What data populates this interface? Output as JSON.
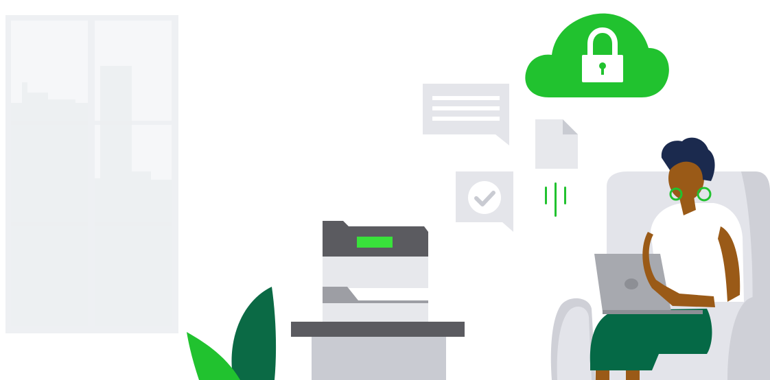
{
  "scene": {
    "description_free": true,
    "colors": {
      "background": "#ffffff",
      "window_frame": "#eef0f3",
      "window_pane": "#f6f7f9",
      "city_silhouette": "#eceef1",
      "cloud_green": "#21c22f",
      "lock_white": "#ffffff",
      "bubble_gray": "#e4e5ea",
      "bubble_lines": "#ffffff",
      "check_circle": "#ffffff",
      "check_mark": "#c9cbd2",
      "doc_page": "#e7e8ec",
      "doc_fold": "#c9cbd2",
      "signal_green": "#21c22f",
      "printer_top": "#5b5b60",
      "printer_body": "#e7e8ec",
      "printer_tray": "#9d9ea4",
      "printer_screen": "#39e23b",
      "desk_top": "#5b5b60",
      "desk_body": "#c9cbd2",
      "plant_dark": "#0b6a45",
      "plant_light": "#21c22f",
      "chair": "#e3e4ea",
      "chair_shadow": "#cfd0d7",
      "skin": "#9a5a17",
      "hair": "#1b2a4e",
      "shirt": "#ffffff",
      "skirt": "#056946",
      "laptop": "#a7a9af",
      "laptop_dark": "#8d8f95",
      "earring": "#21c22f"
    },
    "icons": [
      "window-icon",
      "cloud-lock-icon",
      "chat-bubble-lines-icon",
      "chat-bubble-check-icon",
      "document-icon",
      "signal-lines-icon",
      "printer-icon",
      "plant-icon",
      "person-with-laptop-icon"
    ]
  }
}
